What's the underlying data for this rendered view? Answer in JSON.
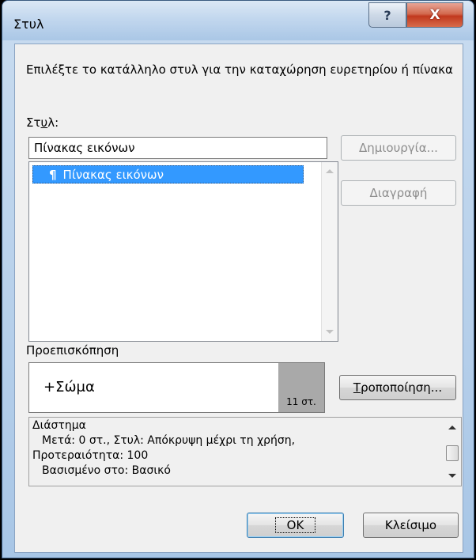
{
  "window": {
    "title": "Στυλ"
  },
  "titlebar": {
    "help_glyph": "?",
    "close_glyph": "X"
  },
  "instructions": "Επιλέξτε το κατάλληλο στυλ για την καταχώρηση ευρετηρίου ή πίνακα",
  "style_label": {
    "pre": "Στ",
    "underlined": "υ",
    "post": "λ:"
  },
  "style_input": {
    "value": "Πίνακας εικόνων"
  },
  "style_list": {
    "items": [
      {
        "mark": "¶",
        "label": "Πίνακας εικόνων",
        "selected": true
      }
    ]
  },
  "buttons": {
    "new_label": "Δημιουργία...",
    "delete_label": "Διαγραφή",
    "modify_label": {
      "underlined": "Τ",
      "rest": "ροποποίηση..."
    },
    "ok_label": "OK",
    "close_label": "Κλείσιμο"
  },
  "preview": {
    "label": "Προεπισκόπηση",
    "font_text": "+Σώμα",
    "size_text": "11 στ."
  },
  "description": {
    "lines": [
      "Διάστημα",
      "Μετά:  0 στ., Στυλ: Απόκρυψη μέχρι τη χρήση,",
      "Προτεραιότητα: 100",
      "Βασισμένο στο: Βασικό"
    ]
  },
  "colors": {
    "selection": "#3399ff",
    "dialog_bg": "#f0f0f0",
    "close_button": "#c1381d"
  }
}
